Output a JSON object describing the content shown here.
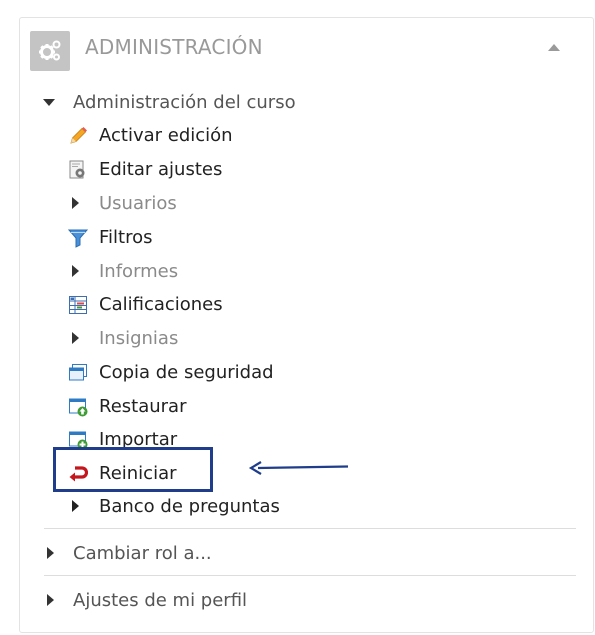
{
  "block": {
    "title": "ADMINISTRACIÓN",
    "header_icon": "gears-icon",
    "collapse_icon": "caret-up-icon"
  },
  "course_admin": {
    "label": "Administración del curso",
    "items": [
      {
        "label": "Activar edición",
        "icon": "pencil-icon",
        "type": "link"
      },
      {
        "label": "Editar ajustes",
        "icon": "settings-doc-icon",
        "type": "link"
      },
      {
        "label": "Usuarios",
        "icon": "caret-right-icon",
        "type": "submenu"
      },
      {
        "label": "Filtros",
        "icon": "funnel-icon",
        "type": "link"
      },
      {
        "label": "Informes",
        "icon": "caret-right-icon",
        "type": "submenu"
      },
      {
        "label": "Calificaciones",
        "icon": "grades-table-icon",
        "type": "link"
      },
      {
        "label": "Insignias",
        "icon": "caret-right-icon",
        "type": "submenu"
      },
      {
        "label": "Copia de seguridad",
        "icon": "backup-icon",
        "type": "link"
      },
      {
        "label": "Restaurar",
        "icon": "restore-icon",
        "type": "link"
      },
      {
        "label": "Importar",
        "icon": "import-icon",
        "type": "link"
      },
      {
        "label": "Reiniciar",
        "icon": "reset-return-icon",
        "type": "link",
        "highlighted": true
      },
      {
        "label": "Banco de preguntas",
        "icon": "caret-right-icon",
        "type": "submenu"
      }
    ]
  },
  "other_sections": [
    {
      "label": "Cambiar rol a..."
    },
    {
      "label": "Ajustes de mi perfil"
    }
  ],
  "annotation": {
    "highlight_color": "#1f3d8a",
    "arrow_color": "#1f3d8a",
    "arrow_icon": "arrow-left-icon"
  },
  "colors": {
    "title": "#999999",
    "link": "#222222",
    "submenu": "#8a8a8a"
  }
}
